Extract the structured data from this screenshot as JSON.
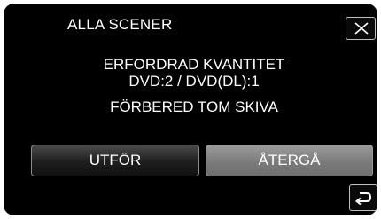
{
  "dialog": {
    "title": "ALLA SCENER",
    "message_line1": "ERFORDRAD KVANTITET",
    "message_line2": "DVD:2 / DVD(DL):1",
    "message_line3": "FÖRBERED TOM SKIVA"
  },
  "buttons": {
    "execute_label": "UTFÖR",
    "return_label": "ÅTERGÅ"
  },
  "icons": {
    "close": "close-icon",
    "back": "back-arrow-icon"
  },
  "colors": {
    "background": "#000000",
    "text": "#ffffff",
    "button_dark": "#1e1e1e",
    "button_gray": "#7c7c7c"
  }
}
